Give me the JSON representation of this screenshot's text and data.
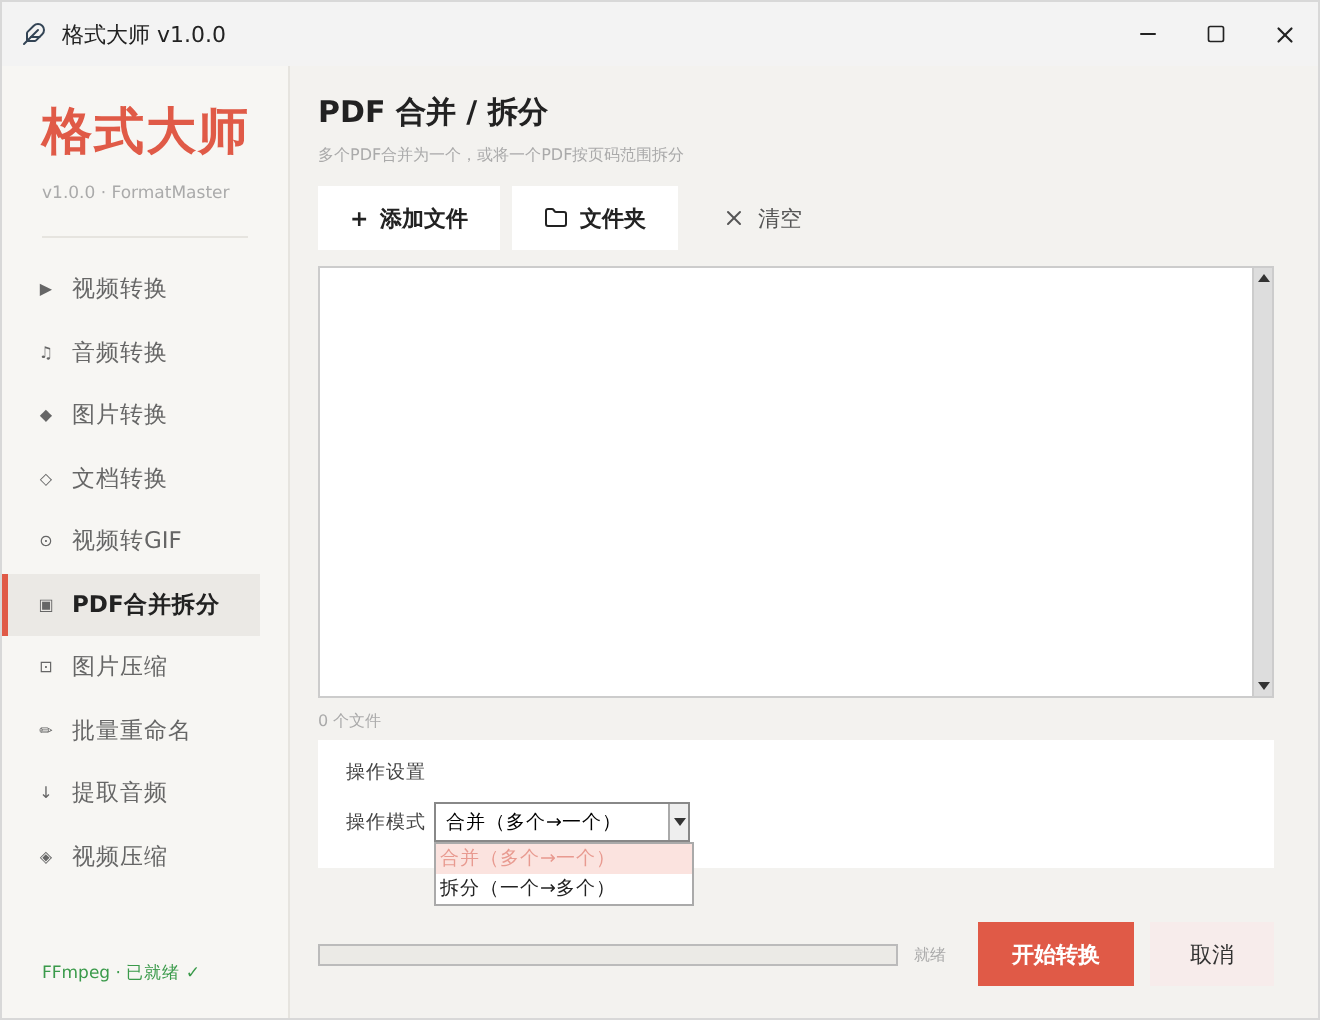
{
  "window": {
    "title": "格式大师 v1.0.0"
  },
  "sidebar": {
    "logo": "格式大师",
    "version": "v1.0.0 · FormatMaster",
    "items": [
      {
        "icon": "▶",
        "label": "视频转换",
        "selected": false
      },
      {
        "icon": "♫",
        "label": "音频转换",
        "selected": false
      },
      {
        "icon": "◆",
        "label": "图片转换",
        "selected": false
      },
      {
        "icon": "◇",
        "label": "文档转换",
        "selected": false
      },
      {
        "icon": "⊙",
        "label": "视频转GIF",
        "selected": false
      },
      {
        "icon": "▣",
        "label": "PDF合并拆分",
        "selected": true
      },
      {
        "icon": "⊡",
        "label": "图片压缩",
        "selected": false
      },
      {
        "icon": "✏",
        "label": "批量重命名",
        "selected": false
      },
      {
        "icon": "↓",
        "label": "提取音频",
        "selected": false
      },
      {
        "icon": "◈",
        "label": "视频压缩",
        "selected": false
      }
    ],
    "status": "FFmpeg · 已就绪 ✓"
  },
  "page": {
    "title": "PDF 合并 / 拆分",
    "subtitle": "多个PDF合并为一个，或将一个PDF按页码范围拆分"
  },
  "toolbar": [
    {
      "kind": "add",
      "icon": "+",
      "label": "添加文件"
    },
    {
      "kind": "folder",
      "label": "文件夹"
    },
    {
      "kind": "clear",
      "label": "清空"
    }
  ],
  "file_count": "0 个文件",
  "settings": {
    "title": "操作设置",
    "mode_label": "操作模式",
    "mode_value": "合并（多个→一个）",
    "options": [
      {
        "label": "合并（多个→一个）",
        "selected": true
      },
      {
        "label": "拆分（一个→多个）",
        "selected": false
      }
    ]
  },
  "progress": {
    "level": 0,
    "status": "就绪"
  },
  "buttons": {
    "start": "开始转换",
    "cancel": "取消"
  }
}
